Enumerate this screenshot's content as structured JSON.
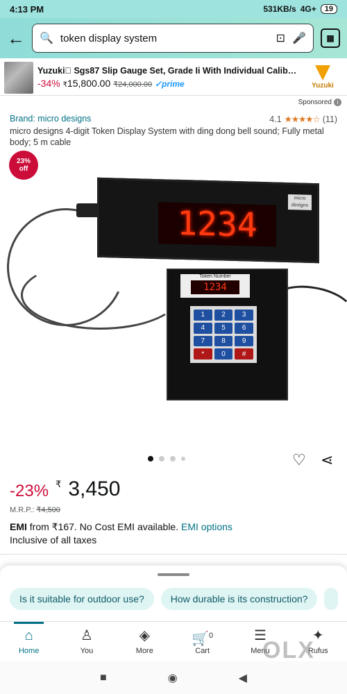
{
  "status": {
    "time": "4:13 PM",
    "speed": "531KB/s",
    "signal": "4G+",
    "battery": "19"
  },
  "search": {
    "back_icon": "arrow-left-icon",
    "query": "token display system",
    "scan_label": ""
  },
  "banner": {
    "title": "Yuzuki\u0000 Sgs87 Slip Gauge Set, Grade Ii With Individual Calibration...",
    "discount": "-34%",
    "currency": "₹",
    "price": "15,800.00",
    "mrp": "₹24,000.00",
    "prime": "✓prime",
    "brand": "Yuzuki"
  },
  "sponsored": "Sponsored",
  "product": {
    "brand": "Brand: micro designs",
    "rating_value": "4.1",
    "stars": "★★★★☆",
    "rating_count": "(11)",
    "title": "micro designs 4-digit Token Display System with ding dong bell sound; Fully metal body; 5 m cable",
    "badge_pct": "23%",
    "badge_off": "off",
    "display_digits": "1234",
    "display_label": "micro designs",
    "keypad_label": "Token Number",
    "keypad_digits": "1234",
    "keys": [
      "1",
      "2",
      "3",
      "4",
      "5",
      "6",
      "7",
      "8",
      "9",
      "*",
      "0",
      "#"
    ]
  },
  "pricing": {
    "discount": "-23%",
    "currency": "₹",
    "price": "3,450",
    "mrp_label": "M.R.P.:",
    "mrp_value": "₹4,500",
    "emi_bold": "EMI",
    "emi_text": "from ₹167. No Cost EMI available.",
    "emi_link": "EMI options",
    "taxes": "Inclusive of all taxes"
  },
  "chips": [
    "Is it suitable for outdoor use?",
    "How durable is its construction?"
  ],
  "nav": [
    {
      "label": "Home",
      "icon": "home-icon",
      "glyph": "⌂"
    },
    {
      "label": "You",
      "icon": "person-icon",
      "glyph": "♙"
    },
    {
      "label": "More",
      "icon": "layers-icon",
      "glyph": "◈"
    },
    {
      "label": "Cart",
      "icon": "cart-icon",
      "glyph": "🛒",
      "count": "0"
    },
    {
      "label": "Menu",
      "icon": "menu-icon",
      "glyph": "☰"
    },
    {
      "label": "Rufus",
      "icon": "rufus-icon",
      "glyph": "✦"
    }
  ],
  "watermark": "OLX"
}
